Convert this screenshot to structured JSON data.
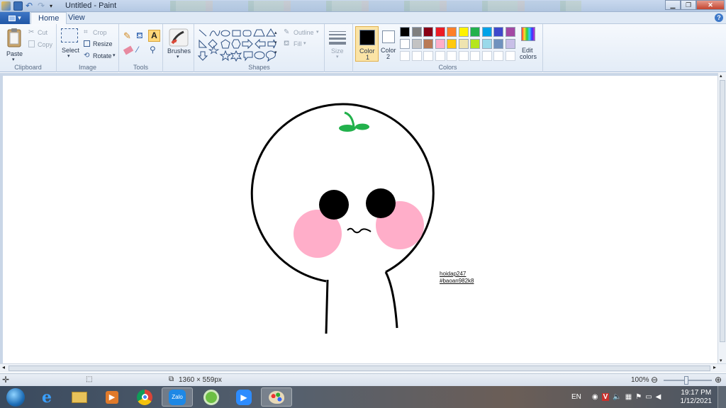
{
  "window": {
    "title": "Untitled - Paint"
  },
  "ribbon_tabs": {
    "home": "Home",
    "view": "View"
  },
  "clipboard": {
    "paste": "Paste",
    "cut": "Cut",
    "copy": "Copy",
    "group": "Clipboard"
  },
  "image": {
    "select": "Select",
    "crop": "Crop",
    "resize": "Resize",
    "rotate": "Rotate",
    "group": "Image"
  },
  "tools": {
    "group": "Tools",
    "brushes": "Brushes"
  },
  "shapes": {
    "outline": "Outline",
    "fill": "Fill",
    "group": "Shapes"
  },
  "size": {
    "label": "Size"
  },
  "colors": {
    "color1_label": "Color",
    "color1_num": "1",
    "color2_label": "Color",
    "color2_num": "2",
    "edit_label": "Edit",
    "edit_label2": "colors",
    "group": "Colors",
    "color1": "#000000",
    "color2": "#ffffff",
    "palette_row1": [
      "#000000",
      "#7f7f7f",
      "#880015",
      "#ed1c24",
      "#ff7f27",
      "#fff200",
      "#22b14c",
      "#00a2e8",
      "#3f48cc",
      "#a349a4"
    ],
    "palette_row2": [
      "#ffffff",
      "#c3c3c3",
      "#b97a57",
      "#ffaec9",
      "#ffc90e",
      "#efe4b0",
      "#b5e61d",
      "#99d9ea",
      "#7092be",
      "#c8bfe7"
    ]
  },
  "canvas_text": {
    "line1": "hoidap247",
    "line2": "#baoan982k8"
  },
  "status": {
    "size": "1360 × 559px",
    "zoom": "100%"
  },
  "taskbar": {
    "lang": "EN",
    "time": "19:17 PM",
    "date": "1/12/2021",
    "zalo": "Zalo"
  },
  "drawing_colors": {
    "outline": "#000000",
    "cheek": "#ffaec9",
    "sprout": "#22b14c"
  }
}
